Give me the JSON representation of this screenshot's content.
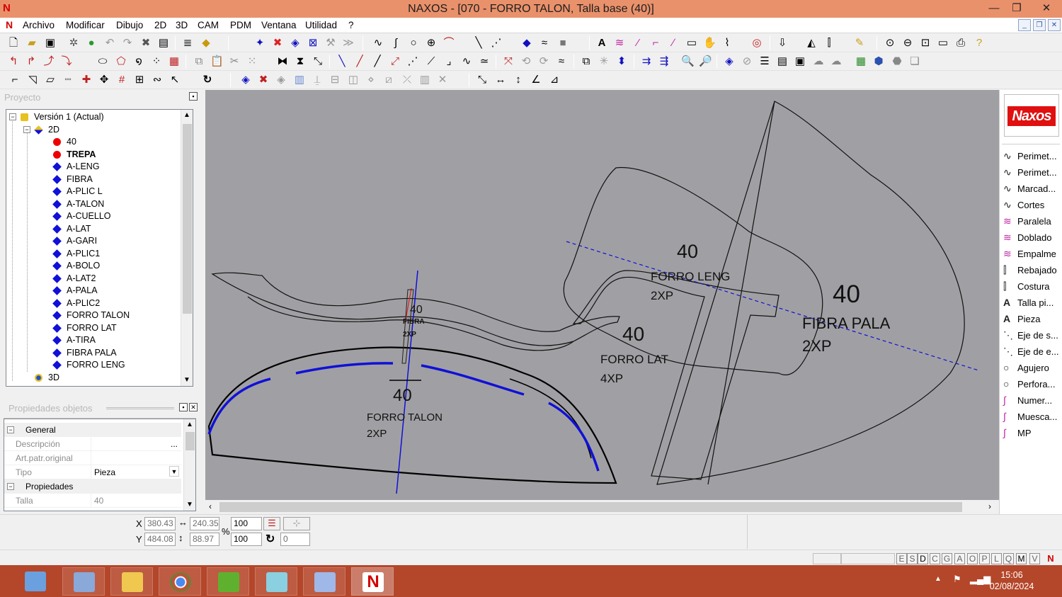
{
  "window": {
    "title": "NAXOS - [070 - FORRO TALON, Talla base (40)]",
    "minimize": "—",
    "restore": "❐",
    "close": "✕"
  },
  "menu": [
    "Archivo",
    "Modificar",
    "Dibujo",
    "2D",
    "3D",
    "CAM",
    "PDM",
    "Ventana",
    "Utilidad",
    "?"
  ],
  "project_panel": {
    "header": "Proyecto",
    "tree": [
      {
        "label": "Versión 1 (Actual)",
        "type": "root",
        "bold": false
      },
      {
        "label": "2D",
        "type": "folder",
        "bold": false
      },
      {
        "label": "40",
        "type": "red",
        "bold": false
      },
      {
        "label": "TREPA",
        "type": "red",
        "bold": true
      },
      {
        "label": "A-LENG",
        "type": "blue",
        "bold": false
      },
      {
        "label": "FIBRA",
        "type": "blue",
        "bold": false
      },
      {
        "label": "A-PLIC L",
        "type": "blue",
        "bold": false
      },
      {
        "label": "A-TALON",
        "type": "blue",
        "bold": false
      },
      {
        "label": "A-CUELLO",
        "type": "blue",
        "bold": false
      },
      {
        "label": "A-LAT",
        "type": "blue",
        "bold": false
      },
      {
        "label": "A-GARI",
        "type": "blue",
        "bold": false
      },
      {
        "label": "A-PLIC1",
        "type": "blue",
        "bold": false
      },
      {
        "label": "A-BOLO",
        "type": "blue",
        "bold": false
      },
      {
        "label": "A-LAT2",
        "type": "blue",
        "bold": false
      },
      {
        "label": "A-PALA",
        "type": "blue",
        "bold": false
      },
      {
        "label": "A-PLIC2",
        "type": "blue",
        "bold": false
      },
      {
        "label": "FORRO TALON",
        "type": "blue",
        "bold": false
      },
      {
        "label": "FORRO LAT",
        "type": "blue",
        "bold": false
      },
      {
        "label": "A-TIRA",
        "type": "blue",
        "bold": false
      },
      {
        "label": "FIBRA PALA",
        "type": "blue",
        "bold": false
      },
      {
        "label": "FORRO LENG",
        "type": "blue",
        "bold": false
      },
      {
        "label": "3D",
        "type": "folder3d",
        "bold": false
      }
    ]
  },
  "props_panel": {
    "header": "Propiedades objetos",
    "cat_general": "General",
    "descripcion_label": "Descripción",
    "descripcion_value": "",
    "ellipsis": "...",
    "art_label": "Art.patr.original",
    "art_value": "",
    "tipo_label": "Tipo",
    "tipo_value": "Pieza",
    "cat_propiedades": "Propiedades",
    "talla_label": "Talla",
    "talla_value": "40"
  },
  "canvas_labels": {
    "forro_leng": {
      "size": "40",
      "name": "FORRO LENG",
      "qty": "2XP"
    },
    "fibra_pala": {
      "size": "40",
      "name": "FIBRA PALA",
      "qty": "2XP"
    },
    "forro_lat": {
      "size": "40",
      "name": "FORRO LAT",
      "qty": "4XP"
    },
    "forro_talon": {
      "size": "40",
      "name": "FORRO TALON",
      "qty": "2XP"
    },
    "fibra": {
      "size": "40",
      "name": "FIBRA",
      "qty": "2XP"
    }
  },
  "right_tools": {
    "logo": "Naxos",
    "items": [
      "Perimet...",
      "Perimet...",
      "Marcad...",
      "Cortes",
      "Paralela",
      "Doblado",
      "Empalme",
      "Rebajado",
      "Costura",
      "Talla pi...",
      "Pieza",
      "Eje de s...",
      "Eje de e...",
      "Agujero",
      "Perfora...",
      "Numer...",
      "Muesca...",
      "MP"
    ]
  },
  "coords": {
    "x_label": "X",
    "y_label": "Y",
    "x": "380.43",
    "y": "484.08",
    "w": "240.35",
    "h": "88.97",
    "scale_x": "100",
    "scale_y": "100",
    "rotation": "0",
    "percent": "%"
  },
  "status_letters": [
    "E",
    "S",
    "D",
    "C",
    "G",
    "A",
    "O",
    "P",
    "L",
    "Q",
    "M",
    "V"
  ],
  "clock": {
    "time": "15:06",
    "date": "02/08/2024"
  },
  "colors": {
    "titlebar": "#e9916b",
    "taskbar": "#b4462a",
    "canvas": "#a0a0a4",
    "accent_blue": "#1010d8",
    "accent_red": "#e01010"
  }
}
